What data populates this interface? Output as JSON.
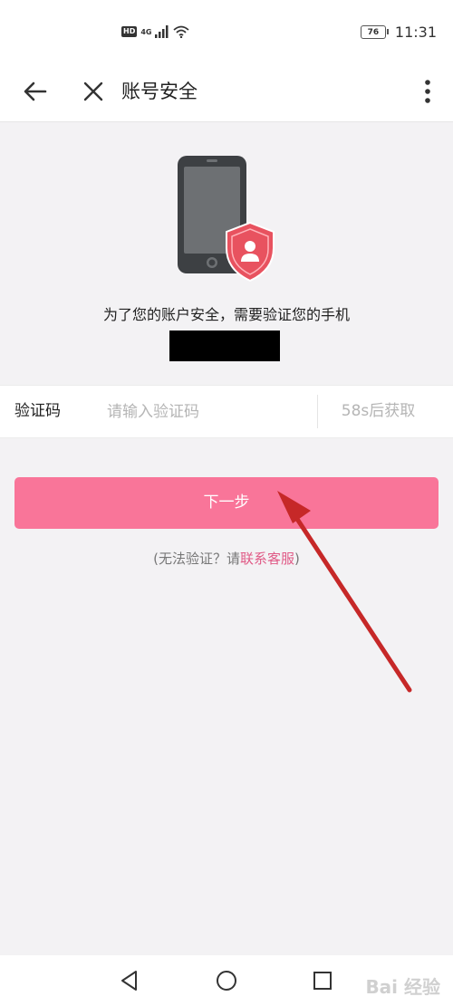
{
  "status_bar": {
    "hd": "HD",
    "network": "4G",
    "battery": "76",
    "time": "11:31"
  },
  "header": {
    "title": "账号安全",
    "icons": [
      "back-arrow-icon",
      "close-icon",
      "more-vert-icon"
    ]
  },
  "verify": {
    "hint": "为了您的账户安全，需要验证您的手机"
  },
  "code_field": {
    "label": "验证码",
    "placeholder": "请输入验证码",
    "value": "",
    "resend": "58s后获取"
  },
  "next_button": {
    "label": "下一步"
  },
  "help": {
    "prefix": "(无法验证？请",
    "link": "联系客服",
    "suffix": ")"
  },
  "colors": {
    "accent": "#f97599",
    "link": "#e05a86",
    "annotation_arrow": "#c62828",
    "shield": "#e8525f"
  },
  "watermark": "Bai 经验"
}
